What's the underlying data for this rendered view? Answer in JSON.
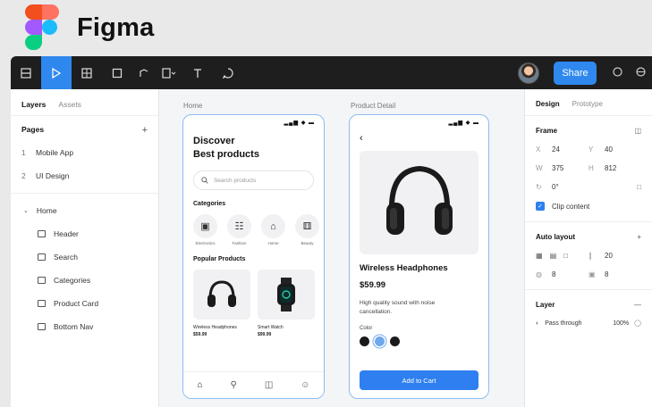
{
  "brand": {
    "name": "Figma",
    "colors": [
      "#f24e1e",
      "#ff7262",
      "#a259ff",
      "#1abcfe",
      "#0acf83"
    ]
  },
  "toolbar": {
    "tools": [
      "frame-tool",
      "move-tool",
      "grid-tool",
      "shape-tool",
      "pen-tool",
      "text-tool",
      "comment-tool"
    ],
    "share_label": "Share",
    "accent": "#2f88ee"
  },
  "left_panel": {
    "tab_layers": "Layers",
    "tab_assets": "Assets",
    "pages_heading": "Pages",
    "pages": [
      {
        "num": "1",
        "label": "Mobile App"
      },
      {
        "num": "2",
        "label": "UI Design"
      }
    ],
    "layers_root": "Home",
    "layers": [
      "Header",
      "Search",
      "Categories",
      "Product Card",
      "Bottom Nav"
    ]
  },
  "canvas": {
    "home_label": "Home",
    "detail_label": "Product Detail",
    "home": {
      "title_line1": "Discover",
      "title_line2": "Best products",
      "search_placeholder": "Search products",
      "categories_heading": "Categories",
      "categories": [
        "Electronics",
        "Fashion",
        "Home",
        "Beauty"
      ],
      "popular_heading": "Popular Products",
      "products": [
        {
          "name": "Wireless Headphones",
          "price": "$59.99"
        },
        {
          "name": "Smart Watch",
          "price": "$99.99"
        }
      ]
    },
    "detail": {
      "name": "Wireless Headphones",
      "price": "$59.99",
      "description": "High quality sound with noise cancellation.",
      "color_label": "Color",
      "swatches": [
        "#1a1a1a",
        "#6fa8ec",
        "#1a1a1a"
      ],
      "cta": "Add to Cart"
    }
  },
  "right_panel": {
    "tab_design": "Design",
    "tab_prototype": "Prototype",
    "frame_heading": "Frame",
    "x_label": "X",
    "x_value": "24",
    "y_label": "Y",
    "y_value": "40",
    "w_label": "W",
    "w_value": "375",
    "h_label": "H",
    "h_value": "812",
    "rotation": "0°",
    "clip_content": "Clip content",
    "auto_layout_heading": "Auto layout",
    "gap_value": "20",
    "padding_value": "8",
    "padding_value2": "8",
    "layer_heading": "Layer",
    "blend_mode": "Pass through",
    "opacity": "100%"
  }
}
